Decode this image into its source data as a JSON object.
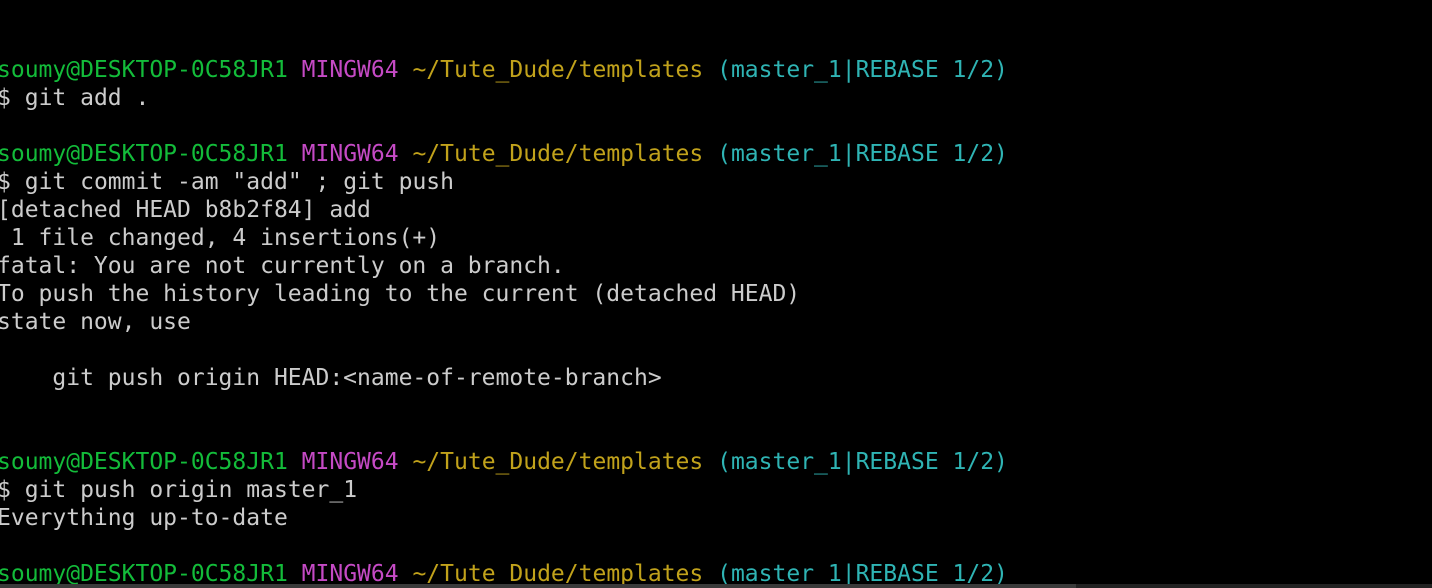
{
  "prompt": {
    "user": "soumy@DESKTOP-0C58JR1",
    "mingw": "MINGW64",
    "path": "~/Tute_Dude/templates",
    "branch": "(master_1|REBASE 1/2)",
    "symbol": "$"
  },
  "blocks": [
    {
      "command": "git add .",
      "output": []
    },
    {
      "command": "git commit -am \"add\" ; git push",
      "output": [
        "[detached HEAD b8b2f84] add",
        " 1 file changed, 4 insertions(+)",
        "fatal: You are not currently on a branch.",
        "To push the history leading to the current (detached HEAD)",
        "state now, use",
        "",
        "    git push origin HEAD:<name-of-remote-branch>",
        ""
      ]
    },
    {
      "command": "git push origin master_1",
      "output": [
        "Everything up-to-date"
      ]
    },
    {
      "command": "",
      "output": []
    }
  ],
  "colors": {
    "background": "#000000",
    "text": "#cccccc",
    "user": "#13bc3a",
    "mingw": "#c54ac5",
    "path": "#c1a21b",
    "branch": "#2fb4b4"
  }
}
